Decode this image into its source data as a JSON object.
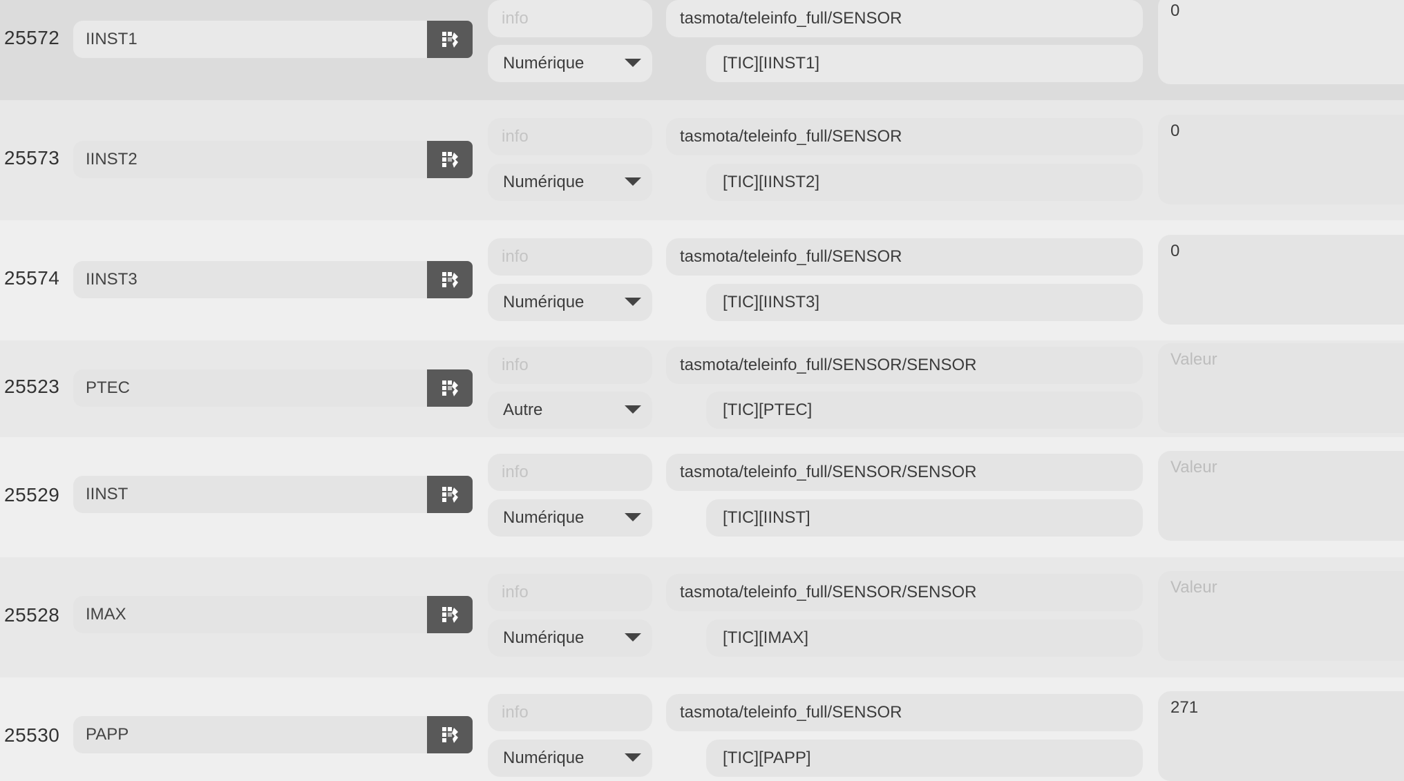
{
  "labels": {
    "type_placeholder": "info",
    "value_placeholder": "Valeur"
  },
  "colors": {
    "background": "#efefef",
    "row_highlight": "#dcdcdc",
    "input_fill": "#e4e4e4",
    "config_button": "#595959",
    "text": "#3c3c3c",
    "placeholder_text": "#c4c4c4"
  },
  "icons": {
    "config": "widget-config-icon",
    "dropdown": "caret-down-icon"
  },
  "commands": [
    {
      "id": "25572",
      "name": "IINST1",
      "subtype": "Numérique",
      "topic": "tasmota/teleinfo_full/SENSOR",
      "json_path": "[TIC][IINST1]",
      "value": "0"
    },
    {
      "id": "25573",
      "name": "IINST2",
      "subtype": "Numérique",
      "topic": "tasmota/teleinfo_full/SENSOR",
      "json_path": "[TIC][IINST2]",
      "value": "0"
    },
    {
      "id": "25574",
      "name": "IINST3",
      "subtype": "Numérique",
      "topic": "tasmota/teleinfo_full/SENSOR",
      "json_path": "[TIC][IINST3]",
      "value": "0"
    },
    {
      "id": "25523",
      "name": "PTEC",
      "subtype": "Autre",
      "topic": "tasmota/teleinfo_full/SENSOR/SENSOR",
      "json_path": "[TIC][PTEC]",
      "value": ""
    },
    {
      "id": "25529",
      "name": "IINST",
      "subtype": "Numérique",
      "topic": "tasmota/teleinfo_full/SENSOR/SENSOR",
      "json_path": "[TIC][IINST]",
      "value": ""
    },
    {
      "id": "25528",
      "name": "IMAX",
      "subtype": "Numérique",
      "topic": "tasmota/teleinfo_full/SENSOR/SENSOR",
      "json_path": "[TIC][IMAX]",
      "value": ""
    },
    {
      "id": "25530",
      "name": "PAPP",
      "subtype": "Numérique",
      "topic": "tasmota/teleinfo_full/SENSOR",
      "json_path": "[TIC][PAPP]",
      "value": "271"
    }
  ]
}
